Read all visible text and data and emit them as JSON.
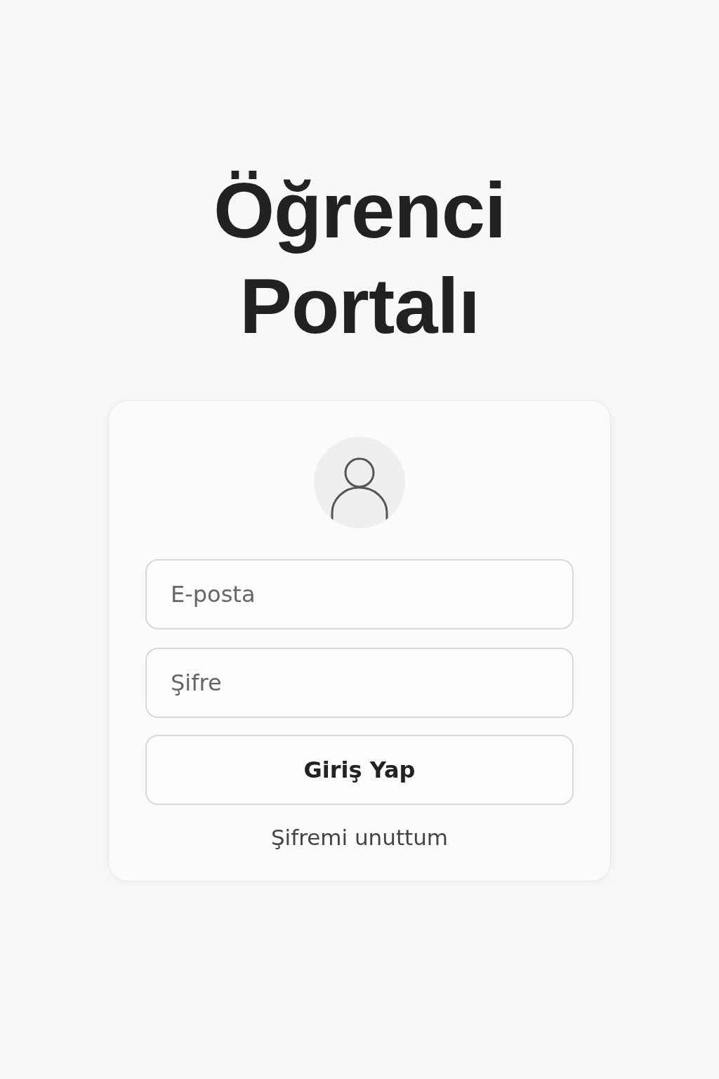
{
  "title": [
    "Öğrenci",
    "Portalı"
  ],
  "login_card": {
    "fields": [
      {
        "placeholder": "E-posta"
      },
      {
        "placeholder": "Şifre"
      }
    ],
    "submit_button": "Giriş Yap",
    "forgot_link": "Şifremi unuttum"
  }
}
